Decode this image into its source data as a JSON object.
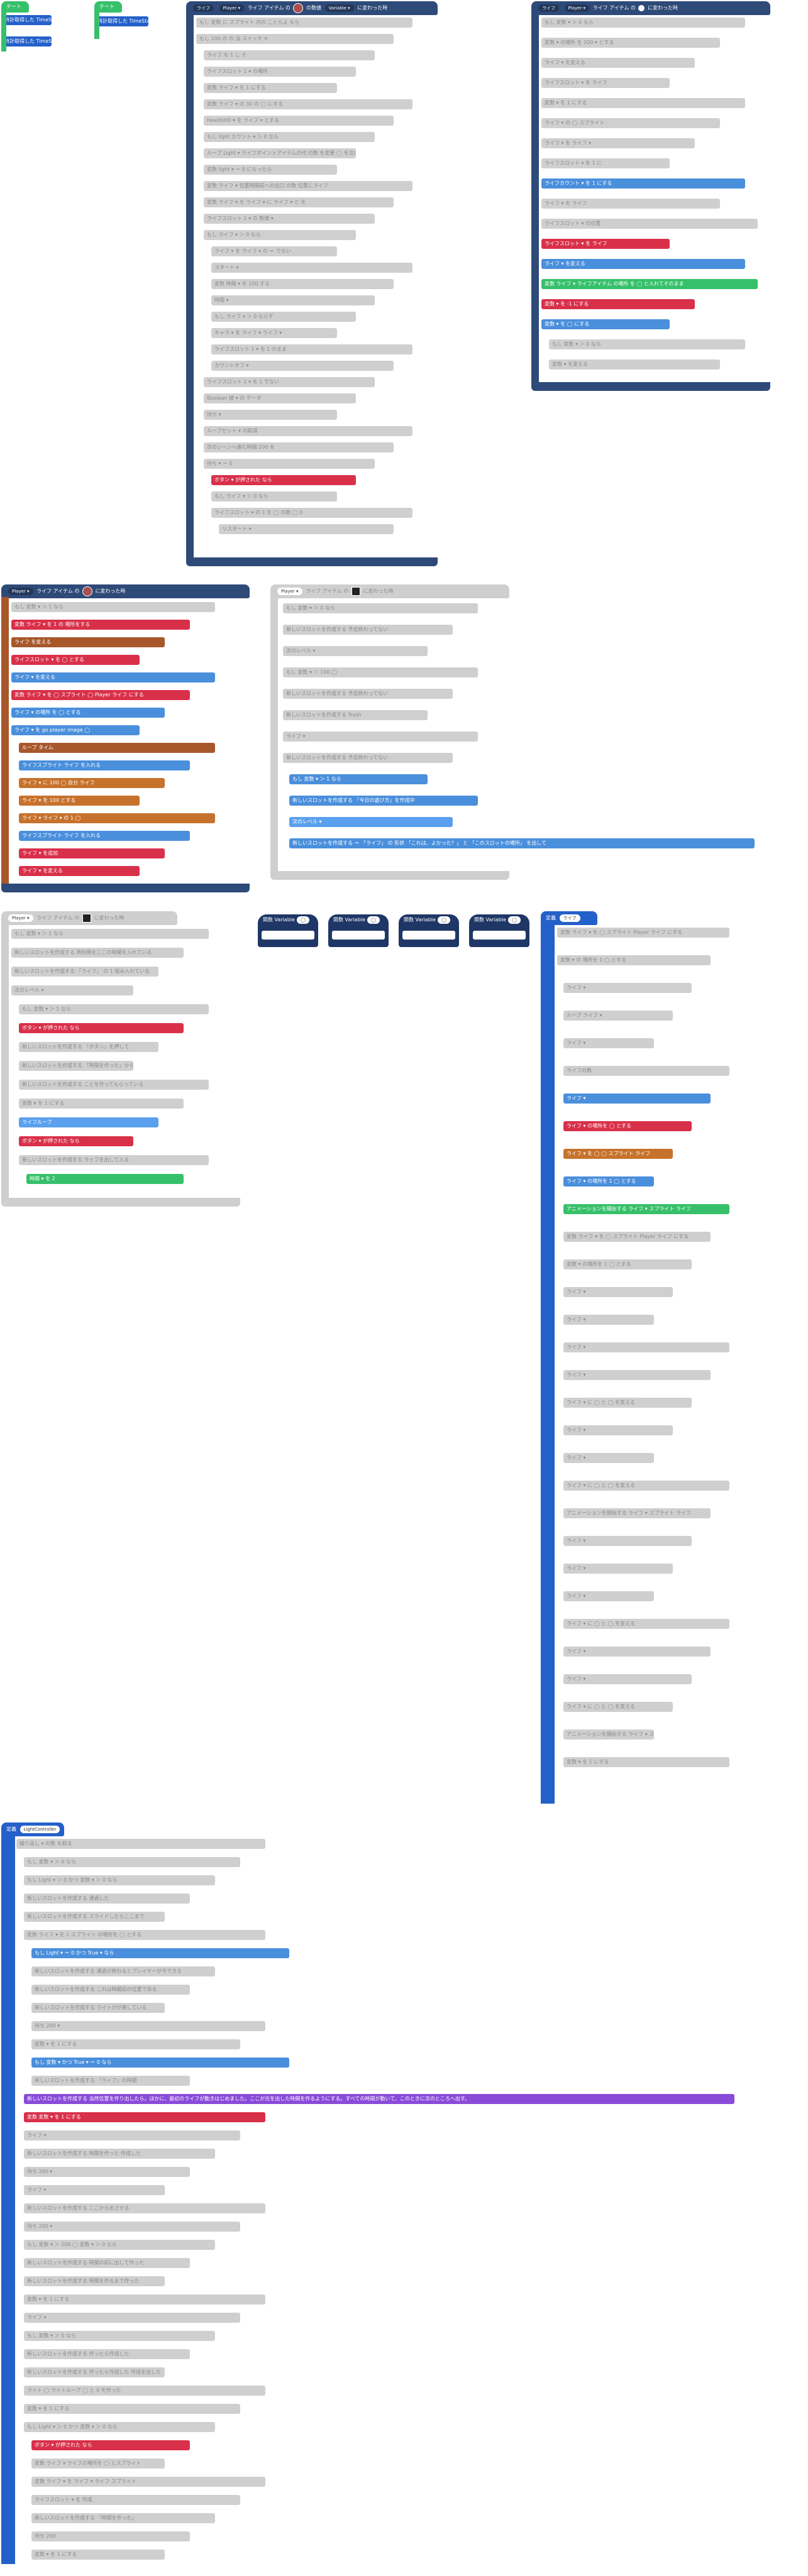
{
  "col1": {
    "chip_blocks": [
      {
        "title": "テート",
        "line1": "時計取得した TimeStamp ▾",
        "line2": "時計取得した TimeStamp ▾"
      },
      {
        "title": "テート",
        "line1": "時計取得した TimeStamp ▾"
      }
    ]
  },
  "block_a": {
    "hat": {
      "label": "ライフ アイテム の",
      "pill1": "ライフ",
      "pill2": "Player ▾",
      "tail": "の数値",
      "tail_pill": "Variable ▾",
      "end": "に変わった時"
    },
    "rows": [
      {
        "text": "もし  変数 に スプライト 内の  ことらよ  なら"
      },
      {
        "text": "もし  100  の  の 当 スイッチ  ✕"
      },
      {
        "text": "ライフ   を  1  し そ"
      },
      {
        "text": "ライフスロット  1  ▾ の場所"
      },
      {
        "text": "変数 ライフ  ▾  を  1  にする"
      },
      {
        "text": "変数  ライフ  ▾ の  30  の  ◯  にする"
      },
      {
        "text": "HealthHD  ▾ を ライフ  ▾  とする"
      },
      {
        "text": "もし  light カウント  ▾  ＞  0  なら"
      },
      {
        "text": "ループ  Light  ▾  ライフポイントアイテムの代  の数 を変更  ◯ を次のレベルに"
      },
      {
        "text": "変数  light  ▾  ＝  0  になったら"
      },
      {
        "text": "変数  ライフ  ▾  位置時間前への出口  の数 位置にライフ"
      },
      {
        "text": "変数  ライフ  ▾  を ライフ  ▾  に  ライフ  ▾  と を"
      },
      {
        "text": "ライフスロット  1  ▾  の 数値  ▾"
      },
      {
        "text": "もし  ライフ  ▾  ＞  0  なら"
      },
      {
        "text": "ライフ  ▾  を  ライフ  ▾  の  ＝  でない"
      },
      {
        "text": "スタート  ▾"
      },
      {
        "text": "変数 時間 ▾  を  100  する"
      },
      {
        "text": "時間  ▾"
      },
      {
        "text": "もし  ライフ  ▾  ＞  0  ならず"
      },
      {
        "text": "キャラ  ▾ を ライフ  ▾  ライフ  ▾"
      },
      {
        "text": "ライフスロット  1  ▾ を  1  のまま"
      },
      {
        "text": "カウントオフ  ▾"
      },
      {
        "text": "ライフスロット  1  ▾  を  1  でない"
      },
      {
        "text": "Boolean 値  ▾  の データ"
      },
      {
        "text": "待ち  ▾"
      },
      {
        "text": "ループセット  ▾  の取得"
      },
      {
        "text": "次のシーンへ進む時間 200 を"
      },
      {
        "text": "待ち  ▾  ＝  0"
      },
      {
        "text": "ボタン  ▾  が押された  なら"
      },
      {
        "text": "もし  ライフ  ▾  ＞  0  なら"
      },
      {
        "text": "ライフスロット  ▾ の 1 を  ◯  の数  ◯  0"
      },
      {
        "text": "リスタート  ▾"
      }
    ]
  },
  "block_b": {
    "hat": {
      "label": "ライフ アイテム の",
      "pill1": "ライフ",
      "pill2": "Player ▾",
      "end": "に変わった時"
    },
    "rows": [
      {
        "text": "もし  変数 ▾  ＞  0  なら"
      },
      {
        "text": "変数  ▾  の場所 を  200  ▾  とする"
      },
      {
        "text": "ライフ   ▾  を変える"
      },
      {
        "text": "ライフスロット  ▾  を  ライフ"
      },
      {
        "text": "変数  ▾  を  1  にする"
      },
      {
        "text": "ライフ  ▾  の  ◯  スプライト"
      },
      {
        "text": "ライフ  ▾  を  ライフ  ▾"
      },
      {
        "text": "ライフスロット  ▾  を  1  に"
      },
      {
        "text": "ライフカウント  ▾  を  1  にする"
      },
      {
        "text": "ライフ ▾  を  ライフ"
      },
      {
        "text": "ライフスロット  ▾  の位置"
      },
      {
        "text": "ライフスロット  ▾  を  ライフ"
      },
      {
        "text": "ライフ ▾  を変える"
      },
      {
        "text": "変数 ライフ  ▾  ライフアイテム  の場所 を  ◯  と入れてそのまま"
      },
      {
        "text": "変数  ▾  を  -1  にする"
      },
      {
        "text": "変数  ▾  を  ◯  にする"
      },
      {
        "text": "もし  変数  ▾  ＞  0  なら"
      },
      {
        "text": "変数  ▾  を変える"
      }
    ]
  },
  "block_c": {
    "hat": {
      "label": "ライフ アイテム の",
      "pill2": "Player ▾",
      "end": "に変わった時"
    },
    "rows": [
      {
        "text": "もし  変数 ▾  ＞  1  なら"
      },
      {
        "text": "変数  ライフ  ▾  を  1  の 場所をする"
      },
      {
        "text": "ライフ  を変える"
      },
      {
        "text": "ライフスロット  ▾  を  ◯  とする"
      },
      {
        "text": "ライフ  ▾  を変える"
      },
      {
        "text": "変数  ライフ  ▾  を  ◯  スプライト  ◯  Player  ライフ  にする"
      },
      {
        "text": "ライフ  ▾  の場所 を  ◯  とする"
      },
      {
        "text": "ライフ  ▾  を  go player image  ◯"
      },
      {
        "text": "ループ  タイム"
      },
      {
        "text": "ライフスプライト  ライフ  を入れる"
      },
      {
        "text": "ライフ  ▾  に  100  ◯  自分  ライフ"
      },
      {
        "text": "ライフ  ▾  を  100  とする"
      },
      {
        "text": "ライフ  ▾  ライフ  ▾  の  1  ◯"
      },
      {
        "text": "ライフスプライト  ライフ  を入れる"
      },
      {
        "text": "ライフ  ▾  を追加"
      },
      {
        "text": "ライフ  ▾  を変える"
      }
    ]
  },
  "block_d": {
    "hat": {
      "label": "ライフ アイテム の",
      "pill2": "Player ▾",
      "end": "に変わった時"
    },
    "rows": [
      {
        "text": "もし  変数  ▾  ＞  0  なら"
      },
      {
        "text": "新しいスロットを作成する  予定終わってない"
      },
      {
        "text": "次のレベル  ▾"
      },
      {
        "text": "もし  変数  ▾  ＞  100  ◯"
      },
      {
        "text": "新しいスロットを作成する  予定終わってない"
      },
      {
        "text": "新しいスロットを作成する  Trash"
      },
      {
        "text": "ライフ ▾"
      },
      {
        "text": "新しいスロットを作成する  予定終わってない"
      },
      {
        "text": "もし  変数  ▾  ＞  1  なら"
      },
      {
        "text": "新しいスロットを作成する  「今日の遊び方」を作成中"
      },
      {
        "text": "次のレベル  ▾"
      },
      {
        "text": "新しいスロットを作成する  ＝ 「ライフ」 の 形状  「これは、よかった？」 と  「このスロットの場所」 を出して"
      }
    ]
  },
  "block_e": {
    "hat": {
      "label": "ライフ アイテム の",
      "pill2": "Player ▾",
      "end": "に変わった時"
    },
    "rows": [
      {
        "text": "もし  変数  ▾  ＞  1  なら"
      },
      {
        "text": "新しいスロットを作成する  再利用をここの時間を入れている"
      },
      {
        "text": "新しいスロットを作成する  「ライフ」 の 1 組み入れている"
      },
      {
        "text": "次のレベル  ▾"
      },
      {
        "text": "もし  変数  ▾  ＞  1  なら"
      },
      {
        "text": "ボタン  ▾  が押された  なら"
      },
      {
        "text": "新しいスロットを作成する  「ボタン」を押して"
      },
      {
        "text": "新しいスロットを作成する  「時間を作った」からすぐに作成"
      },
      {
        "text": "新しいスロットを作成する  ことを作ってもらっている"
      },
      {
        "text": "変数  ▾  を  1  にする"
      },
      {
        "text": "ライフループ"
      },
      {
        "text": "ボタン  ▾  が押された  なら"
      },
      {
        "text": "新しいスロットを作成する  ライフを出して入る"
      },
      {
        "text": "時間  ▾  を  2"
      }
    ]
  },
  "mini_blocks": [
    {
      "label": "関数 Variable",
      "pill": "◯"
    },
    {
      "label": "関数 Variable",
      "pill": "◯"
    },
    {
      "label": "関数 Variable",
      "pill": "◯"
    },
    {
      "label": "関数 Variable",
      "pill": "◯"
    }
  ],
  "block_f": {
    "hat": {
      "label": "定義",
      "pill": "ライフ"
    },
    "rows": [
      {
        "text": "変数  ライフ  ▾ を  ◯  スプライト  Player  ライフ  にする"
      },
      {
        "text": "変数  ▾  の 場所を  1  ◯  とする"
      },
      {
        "text": "ライフ ▾"
      },
      {
        "text": "ループ  ライフ  ▾"
      },
      {
        "text": "ライフ ▾"
      },
      {
        "text": "ライフの数"
      },
      {
        "text": "ライフ  ▾"
      },
      {
        "text": "ライフ  ▾  の場所を  ◯  とする"
      },
      {
        "text": "ライフ  ▾  を  ◯  ◯  スプライト  ライフ"
      },
      {
        "text": "ライフ  ▾  の場所を  1  ◯  とする"
      },
      {
        "text": "アニメーションを開始する  ライフ  ▾  スプライト  ライフ"
      },
      {
        "text": "変数  ライフ  ▾ を  ◯  スプライト  Player  ライフ  にする"
      },
      {
        "text": "変数  ▾  の場所を  1  ◯  とする"
      },
      {
        "text": "ライフ  ▾"
      },
      {
        "text": "ライフ  ▾"
      },
      {
        "text": "ライフ  ▾"
      },
      {
        "text": "ライフ  ▾"
      },
      {
        "text": "ライフ  ▾  に  ◯  と  ◯  を変える"
      },
      {
        "text": "ライフ  ▾"
      },
      {
        "text": "ライフ  ▾"
      },
      {
        "text": "ライフ  ▾  に  ◯  と  ◯  を変える"
      },
      {
        "text": "アニメーションを開始する  ライフ  ▾  スプライト  ライフ"
      },
      {
        "text": "ライフ  ▾"
      },
      {
        "text": "ライフ  ▾"
      },
      {
        "text": "ライフ  ▾"
      },
      {
        "text": "ライフ  ▾  に  ◯  と  ◯  を変える"
      },
      {
        "text": "ライフ  ▾"
      },
      {
        "text": "ライフ  ▾"
      },
      {
        "text": "ライフ  ▾  に  ◯  と  ◯  を変える"
      },
      {
        "text": "アニメーションを開始する  ライフ  ▾  スプライト  ライフ"
      },
      {
        "text": "変数  ▾  を  1  にする"
      }
    ]
  },
  "block_g": {
    "hat": {
      "label": "定義",
      "pill": "LightController"
    },
    "rows": [
      {
        "text": "繰り返し  ▾  の数  を取る"
      },
      {
        "text": "もし  変数  ▾  ＞  0  なら"
      },
      {
        "text": "もし  Light  ▾  ＞  0  かつ  変数  ▾  ＞  0  なら"
      },
      {
        "text": "新しいスロットを作成する  通過した"
      },
      {
        "text": "新しいスロットを作成する  スライドしたらここまで"
      },
      {
        "text": "変数  ライフ  ▾  を  1  スプライト  の場所を  ◯  とする"
      },
      {
        "text": "もし  Light  ▾  ＝  0  かつ  True  ▾  なら"
      },
      {
        "text": "新しいスロットを作成する  通過が終わるとプレイヤーが今できる"
      },
      {
        "text": "新しいスロットを作成する  これは時間前の位置である"
      },
      {
        "text": "新しいスロットを作成する  ライトがが進している"
      },
      {
        "text": "待ち  200  ▾"
      },
      {
        "text": "変数  ▾  を  1  にする"
      },
      {
        "text": "もし  変数  ▾  かつ  True  ▾  ＝  0  なら"
      },
      {
        "text": "新しいスロットを作成する  「ライフ」の時間"
      },
      {
        "text": "新しいスロットを作成する  当然位置を作り出したら。ほかに、最初のライフが動きはじめました。ここが光を出した時間を作るようにする。すべての時間が動いて、このときに次のところへ出す。"
      },
      {
        "text": "変数  変数  ▾  を  1  にする"
      },
      {
        "text": "ライフ  ▾"
      },
      {
        "text": "新しいスロットを作成する  時間を作った  作成した"
      },
      {
        "text": "待ち  200  ▾"
      },
      {
        "text": "ライフ  ▾"
      },
      {
        "text": "新しいスロットを作成する  ここから出させる"
      },
      {
        "text": "待ち  200  ▾"
      },
      {
        "text": "もし  変数  ▾  ＞  200  ◯  変数  ▾  ＞  0  なら"
      },
      {
        "text": "新しいスロットを作成する  時間の前に出して作った"
      },
      {
        "text": "新しいスロットを作成する  時間を作るまで作った"
      },
      {
        "text": "変数  ▾  を  1  にする"
      },
      {
        "text": "ライフ  ▾"
      },
      {
        "text": "もし  変数  ▾  ＞  0  なら"
      },
      {
        "text": "新しいスロットを作成する  作ったら作成した"
      },
      {
        "text": "新しいスロットを作成する  作ったら作成した  作成を出した"
      },
      {
        "text": "ライト  ◯  ライトループ  ◯  と  0  を作った"
      },
      {
        "text": "変数  ▾  を  1  にする"
      },
      {
        "text": "もし  Light  ▾  ＞  0  かつ  変数  ▾  ＞  0  なら"
      },
      {
        "text": "ボタン  ▾  が押された  なら"
      },
      {
        "text": "変数  ライフ  ▾  ライフの場所を  ◯  とスプライト"
      },
      {
        "text": "変数  ライフ  ▾  を  ライフ  ▾  ライフ  スプライト"
      },
      {
        "text": "ライフスロット  ▾  を  作成"
      },
      {
        "text": "新しいスロットを作成する  「時間を作った」"
      },
      {
        "text": "待ち  200"
      },
      {
        "text": "変数  ▾  を  1  にする"
      }
    ]
  }
}
